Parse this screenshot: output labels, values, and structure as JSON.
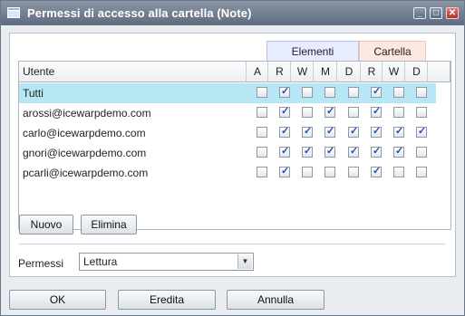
{
  "window": {
    "title": "Permessi di accesso alla cartella (Note)"
  },
  "groups": {
    "elementi": "Elementi",
    "cartella": "Cartella"
  },
  "columns": {
    "utente": "Utente",
    "a": "A",
    "er": "R",
    "ew": "W",
    "em": "M",
    "ed": "D",
    "cr": "R",
    "cw": "W",
    "cd": "D"
  },
  "rows": [
    {
      "name": "Tutti",
      "selected": true,
      "perms": [
        false,
        true,
        false,
        false,
        false,
        true,
        false,
        false
      ]
    },
    {
      "name": "arossi@icewarpdemo.com",
      "selected": false,
      "perms": [
        false,
        true,
        false,
        true,
        false,
        true,
        false,
        false
      ]
    },
    {
      "name": "carlo@icewarpdemo.com",
      "selected": false,
      "perms": [
        false,
        true,
        true,
        true,
        true,
        true,
        true,
        true
      ]
    },
    {
      "name": "gnori@icewarpdemo.com",
      "selected": false,
      "perms": [
        false,
        true,
        true,
        true,
        true,
        true,
        true,
        false
      ]
    },
    {
      "name": "pcarli@icewarpdemo.com",
      "selected": false,
      "perms": [
        false,
        true,
        false,
        false,
        false,
        true,
        false,
        false
      ]
    }
  ],
  "buttons": {
    "nuovo": "Nuovo",
    "elimina": "Elimina",
    "ok": "OK",
    "eredita": "Eredita",
    "annulla": "Annulla"
  },
  "permessi": {
    "label": "Permessi",
    "value": "Lettura"
  },
  "icons": {
    "app": "folder-permissions-icon",
    "minimize": "minimize-icon",
    "maximize": "maximize-icon",
    "close": "close-icon",
    "dropdown": "chevron-down-icon",
    "check": "checkmark-icon"
  },
  "colors": {
    "titlebar": "#6f7b8c",
    "selected_row": "#b7e7f5",
    "elementi_header": "#e8ecff",
    "cartella_header": "#fde8e0",
    "checkmark": "#1c4fb8"
  }
}
